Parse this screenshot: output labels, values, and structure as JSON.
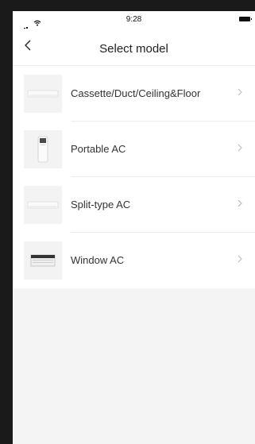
{
  "status_bar": {
    "time": "9:28"
  },
  "header": {
    "title": "Select model"
  },
  "models": [
    {
      "label": "Cassette/Duct/Ceiling&Floor",
      "icon": "cassette-ac-icon"
    },
    {
      "label": "Portable AC",
      "icon": "portable-ac-icon"
    },
    {
      "label": "Split-type AC",
      "icon": "split-ac-icon"
    },
    {
      "label": "Window AC",
      "icon": "window-ac-icon"
    }
  ],
  "colors": {
    "background": "#f4f4f4",
    "surface": "#ffffff",
    "text": "#333333",
    "chevron": "#b8b8b8"
  }
}
